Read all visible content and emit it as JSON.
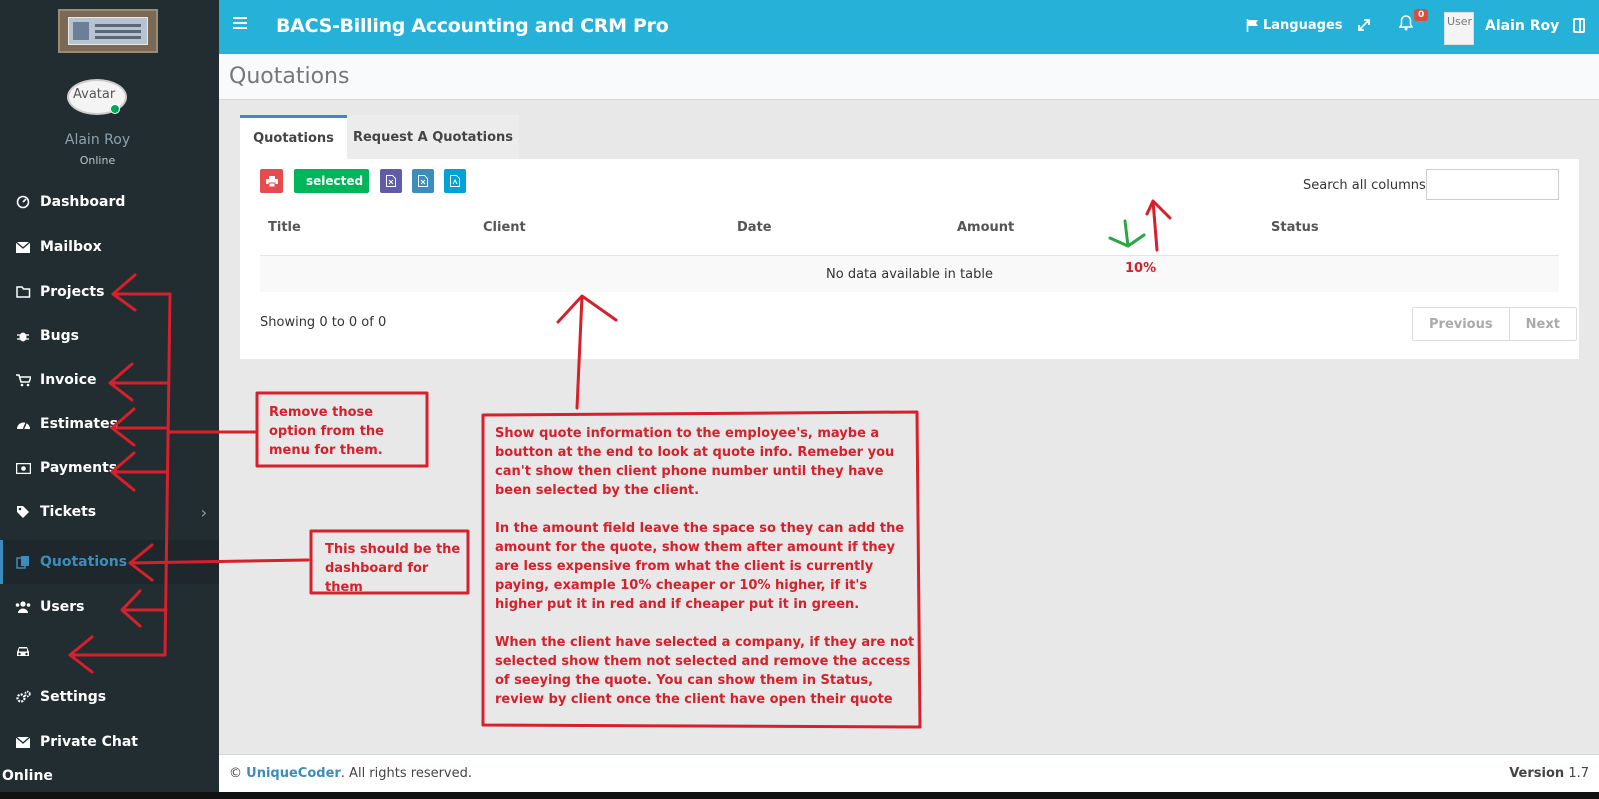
{
  "sidebar": {
    "user_name": "Alain Roy",
    "user_status": "Online",
    "avatar_alt": "Avatar",
    "items": [
      {
        "label": "Dashboard",
        "icon": "dashboard-icon"
      },
      {
        "label": "Mailbox",
        "icon": "envelope-icon"
      },
      {
        "label": "Projects",
        "icon": "folder-icon"
      },
      {
        "label": "Bugs",
        "icon": "bug-icon"
      },
      {
        "label": "Invoice",
        "icon": "cart-icon"
      },
      {
        "label": "Estimates",
        "icon": "gauge-icon"
      },
      {
        "label": "Payments",
        "icon": "money-icon"
      },
      {
        "label": "Tickets",
        "icon": "ticket-icon"
      },
      {
        "label": "Quotations",
        "icon": "files-icon"
      },
      {
        "label": "Users",
        "icon": "users-icon"
      },
      {
        "label": "",
        "icon": "car-icon"
      },
      {
        "label": "Settings",
        "icon": "cogs-icon"
      },
      {
        "label": "Private Chat",
        "icon": "envelope-icon"
      }
    ],
    "bottom_status": "Online"
  },
  "header": {
    "title": "BACS-Billing Accounting and CRM Pro",
    "languages": "Languages",
    "notifications_count": "0",
    "user_img_alt": "User",
    "user_name": "Alain Roy"
  },
  "page": {
    "title": "Quotations",
    "tabs": [
      "Quotations",
      "Request A Quotations"
    ],
    "toolbar": {
      "selected_label": "selected"
    },
    "search_label": "Search all columns:",
    "columns": [
      "Title",
      "Client",
      "Date",
      "Amount",
      "Status"
    ],
    "empty_text": "No data available in table",
    "showing": "Showing 0 to 0 of 0",
    "pager": {
      "previous": "Previous",
      "next": "Next"
    }
  },
  "footer": {
    "copy_prefix": "© ",
    "brand": "UniqueCoder",
    "copy_suffix": ". All rights reserved.",
    "version_label": "Version",
    "version": "1.7"
  },
  "annotations": {
    "note1": "Remove those option from the menu for them.",
    "note2": "This should be the dashboard for them",
    "note3_p1": "Show quote information to the employee's, maybe a boutton at the end to look at quote info. Remeber you can't show then client phone number until they have been selected by the client.",
    "note3_p2": "In the amount field leave the space so they can add the amount for the quote, show them after amount if they are less expensive from what the client is currently paying, example 10% cheaper or 10% higher, if it's higher put it in red and if cheaper put it in green.",
    "note3_p3": "When the client have selected a company, if they are not selected show them not selected and remove the access of seeying the quote. You can show them in Status, review by client once the client have open their quote",
    "percent": "10%"
  },
  "colors": {
    "sidebar": "#222d32",
    "header": "#26b1d9",
    "accent": "#3c8dbc",
    "annotation_red": "#d6202b",
    "annotation_green": "#27a844"
  }
}
